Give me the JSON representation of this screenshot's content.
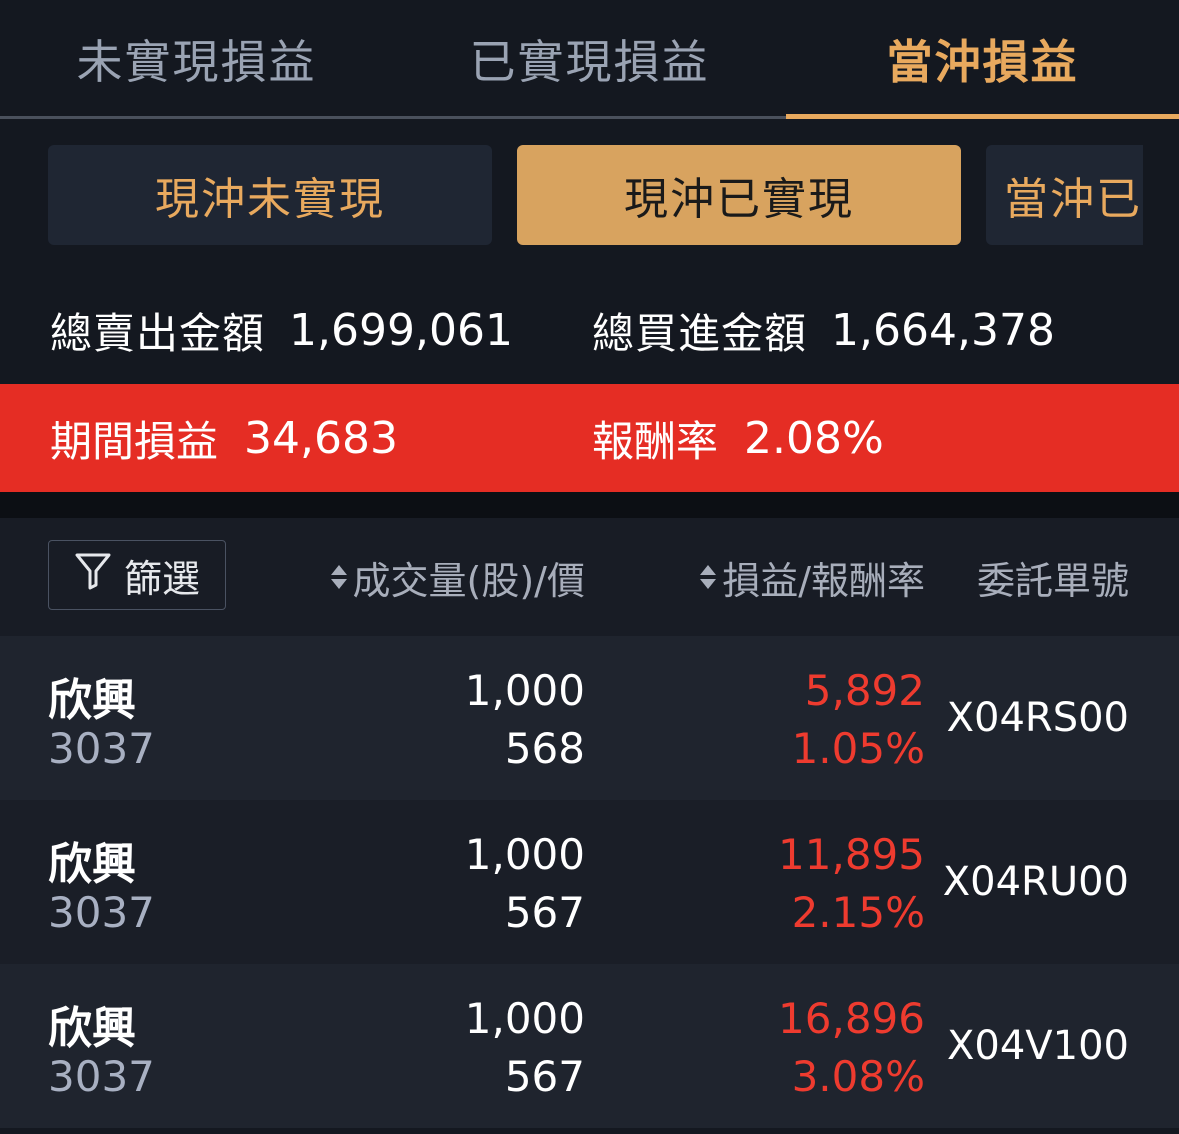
{
  "top_tabs": [
    "未實現損益",
    "已實現損益",
    "當沖損益"
  ],
  "sub_tabs": [
    "現沖未實現",
    "現沖已實現",
    "當沖已"
  ],
  "totals": {
    "sell_label": "總賣出金額",
    "sell_value": "1,699,061",
    "buy_label": "總買進金額",
    "buy_value": "1,664,378"
  },
  "summary": {
    "period_label": "期間損益",
    "period_value": "34,683",
    "rate_label": "報酬率",
    "rate_value": "2.08%"
  },
  "list_header": {
    "filter_label": "篩選",
    "volume_price": "成交量(股)/價",
    "pl_rate": "損益/報酬率",
    "order_no": "委託單號"
  },
  "rows": [
    {
      "name": "欣興",
      "code": "3037",
      "qty": "1,000",
      "price": "568",
      "pl": "5,892",
      "rate": "1.05%",
      "order": "X04RS00"
    },
    {
      "name": "欣興",
      "code": "3037",
      "qty": "1,000",
      "price": "567",
      "pl": "11,895",
      "rate": "2.15%",
      "order": "X04RU00"
    },
    {
      "name": "欣興",
      "code": "3037",
      "qty": "1,000",
      "price": "567",
      "pl": "16,896",
      "rate": "3.08%",
      "order": "X04V100"
    }
  ],
  "colors": {
    "accent": "#e8a95e",
    "loss_profit_red": "#ee3b2f",
    "summary_bar": "#e52d24"
  },
  "icons": {
    "filter": "funnel-icon",
    "sort": "sort-updown-icon"
  }
}
